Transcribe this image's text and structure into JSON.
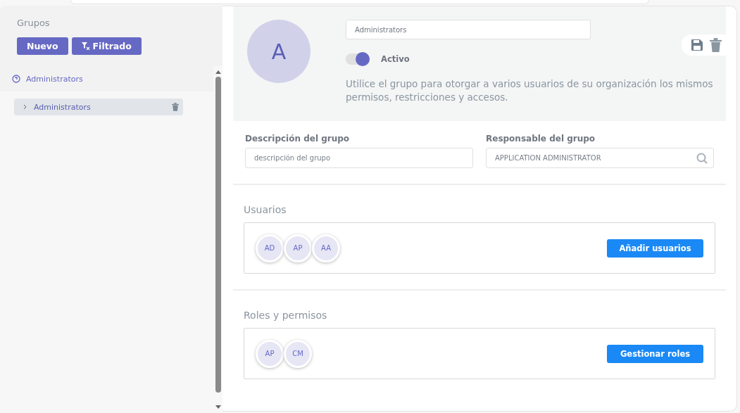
{
  "sidebar": {
    "title": "Grupos",
    "buttons": [
      {
        "label": "Nuevo",
        "kind": "plain"
      },
      {
        "label": "Filtrado",
        "kind": "filter"
      }
    ],
    "tree": {
      "label": "Administrators",
      "children": [
        {
          "label": "Administrators",
          "expanded": false,
          "selected": true
        }
      ]
    }
  },
  "group": {
    "avatar": "A",
    "name": "Administrators",
    "active": {
      "label": "Activo",
      "on": true
    },
    "hint": "Utilice el grupo para otorgar a varios usuarios de su organización los mismos permisos, restricciones y accesos.",
    "description": {
      "label": "Descripción del grupo",
      "placeholder": "descripción del grupo"
    },
    "owner": {
      "label": "Responsable del grupo",
      "value": "APPLICATION ADMINISTRATOR"
    }
  },
  "sections": [
    {
      "title": "Usuarios",
      "avatars": [
        "AD",
        "AP",
        "AA"
      ],
      "button": "Añadir usuarios"
    },
    {
      "title": "Roles y permisos",
      "avatars": [
        "AP",
        "CM"
      ],
      "button": "Gestionar roles"
    }
  ]
}
